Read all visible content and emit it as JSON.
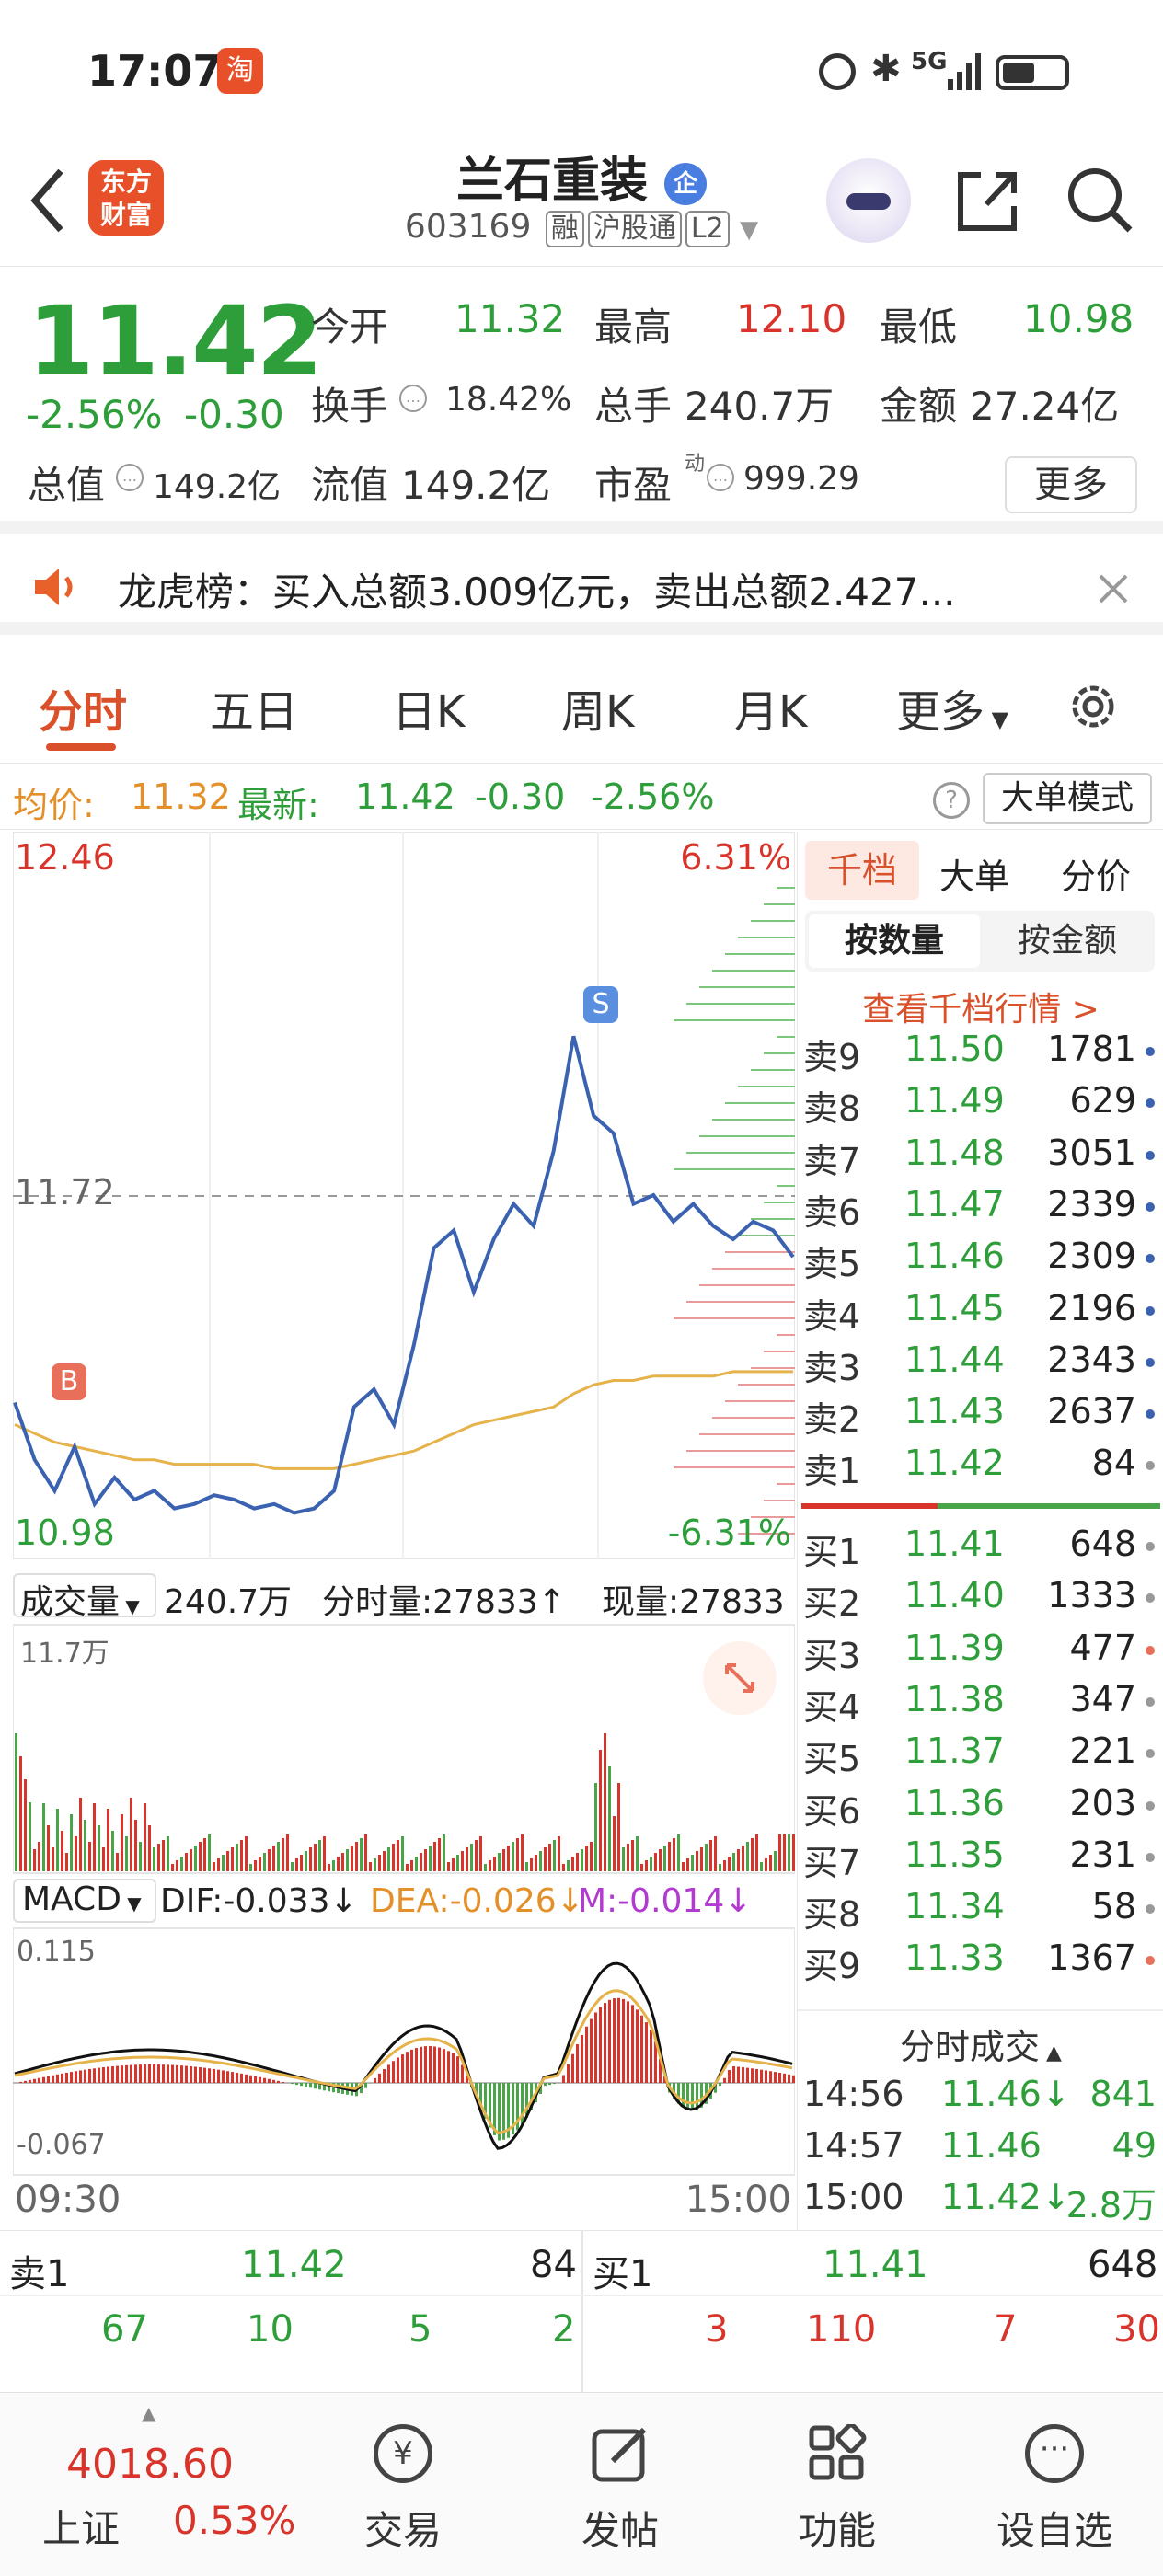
{
  "status": {
    "time": "17:07",
    "network": "5G"
  },
  "header": {
    "title": "兰石重装",
    "corp_tag": "企",
    "code": "603169",
    "tags": [
      "融",
      "沪股通",
      "L2"
    ]
  },
  "logo": {
    "line1": "东方",
    "line2": "财富"
  },
  "quote": {
    "price": "11.42",
    "change_pct": "-2.56%",
    "change": "-0.30",
    "open_label": "今开",
    "open": "11.32",
    "high_label": "最高",
    "high": "12.10",
    "low_label": "最低",
    "low": "10.98",
    "turnover_label": "换手",
    "turnover": "18.42%",
    "volume_label": "总手",
    "volume": "240.7万",
    "amount_label": "金额",
    "amount": "27.24亿",
    "mktcap_label": "总值",
    "mktcap": "149.2亿",
    "float_label": "流值",
    "float": "149.2亿",
    "pe_label": "市盈",
    "pe_sup": "动",
    "pe": "999.29",
    "more": "更多"
  },
  "notice": {
    "text": "龙虎榜：买入总额3.009亿元，卖出总额2.427..."
  },
  "tabs": {
    "items": [
      "分时",
      "五日",
      "日K",
      "周K",
      "月K"
    ],
    "more": "更多"
  },
  "avgrow": {
    "avg_label": "均价:",
    "avg": "11.32",
    "last_label": "最新:",
    "last": "11.42",
    "chg": "-0.30",
    "pct": "-2.56%",
    "mode": "大单模式"
  },
  "chart_labels": {
    "max": "12.46",
    "max_pct": "6.31%",
    "ref": "11.72",
    "min": "10.98",
    "min_pct": "-6.31%",
    "b": "B",
    "s": "S",
    "vol_label": "成交量",
    "vol_total": "240.7万",
    "vol_tick": "分时量:27833↑",
    "vol_now": "现量:27833",
    "vol_max": "11.7万",
    "macd_label": "MACD",
    "dif": "DIF:-0.033↓",
    "dea": "DEA:-0.026↓",
    "m": "M:-0.014↓",
    "macd_max": "0.115",
    "macd_min": "-0.067",
    "t_start": "09:30",
    "t_end": "15:00"
  },
  "colors": {
    "up": "#d9342b",
    "down": "#2e9e3a",
    "price_line": "#3a62b0",
    "avg_line": "#e6b24a"
  },
  "chart_data": {
    "type": "line",
    "x_range": [
      "09:30",
      "15:00"
    ],
    "ylim": [
      10.98,
      12.46
    ],
    "ref_price": 11.72,
    "price": [
      11.25,
      11.12,
      11.05,
      11.15,
      11.02,
      11.08,
      11.03,
      11.05,
      11.01,
      11.02,
      11.04,
      11.03,
      11.01,
      11.02,
      11.0,
      11.01,
      11.05,
      11.24,
      11.28,
      11.2,
      11.38,
      11.6,
      11.64,
      11.5,
      11.62,
      11.7,
      11.65,
      11.82,
      12.08,
      11.9,
      11.86,
      11.7,
      11.72,
      11.66,
      11.7,
      11.65,
      11.62,
      11.66,
      11.64,
      11.58
    ],
    "avg": [
      11.2,
      11.18,
      11.16,
      11.15,
      11.14,
      11.13,
      11.12,
      11.12,
      11.11,
      11.11,
      11.11,
      11.11,
      11.11,
      11.1,
      11.1,
      11.1,
      11.1,
      11.11,
      11.12,
      11.13,
      11.14,
      11.16,
      11.18,
      11.2,
      11.21,
      11.22,
      11.23,
      11.24,
      11.27,
      11.29,
      11.3,
      11.3,
      11.31,
      11.31,
      11.31,
      11.31,
      11.32,
      11.32,
      11.32,
      11.32
    ]
  },
  "book": {
    "tabs": [
      "千档",
      "大单",
      "分价"
    ],
    "sub": [
      "按数量",
      "按金额"
    ],
    "link": "查看千档行情 >",
    "asks": [
      {
        "n": "卖9",
        "p": "11.50",
        "q": "1781"
      },
      {
        "n": "卖8",
        "p": "11.49",
        "q": "629"
      },
      {
        "n": "卖7",
        "p": "11.48",
        "q": "3051"
      },
      {
        "n": "卖6",
        "p": "11.47",
        "q": "2339"
      },
      {
        "n": "卖5",
        "p": "11.46",
        "q": "2309"
      },
      {
        "n": "卖4",
        "p": "11.45",
        "q": "2196"
      },
      {
        "n": "卖3",
        "p": "11.44",
        "q": "2343"
      },
      {
        "n": "卖2",
        "p": "11.43",
        "q": "2637"
      },
      {
        "n": "卖1",
        "p": "11.42",
        "q": "84"
      }
    ],
    "bids": [
      {
        "n": "买1",
        "p": "11.41",
        "q": "648"
      },
      {
        "n": "买2",
        "p": "11.40",
        "q": "1333"
      },
      {
        "n": "买3",
        "p": "11.39",
        "q": "477"
      },
      {
        "n": "买4",
        "p": "11.38",
        "q": "347"
      },
      {
        "n": "买5",
        "p": "11.37",
        "q": "221"
      },
      {
        "n": "买6",
        "p": "11.36",
        "q": "203"
      },
      {
        "n": "买7",
        "p": "11.35",
        "q": "231"
      },
      {
        "n": "买8",
        "p": "11.34",
        "q": "58"
      },
      {
        "n": "买9",
        "p": "11.33",
        "q": "1367"
      }
    ],
    "trades_title": "分时成交",
    "trades": [
      {
        "t": "14:56",
        "p": "11.46↓",
        "v": "841"
      },
      {
        "t": "14:57",
        "p": "11.46",
        "v": "49"
      },
      {
        "t": "15:00",
        "p": "11.42↓",
        "v": "2.8万"
      }
    ]
  },
  "summary": {
    "sell_label": "卖1",
    "sell_price": "11.42",
    "sell_qty": "84",
    "buy_label": "买1",
    "buy_price": "11.41",
    "buy_qty": "648",
    "sell_queue": [
      "67",
      "10",
      "5",
      "2"
    ],
    "buy_queue": [
      "3",
      "110",
      "7",
      "30"
    ]
  },
  "nav": {
    "index_value": "4018.60",
    "index_name": "上证",
    "index_pct": "0.53%",
    "items": [
      "交易",
      "发帖",
      "功能",
      "设自选"
    ]
  }
}
